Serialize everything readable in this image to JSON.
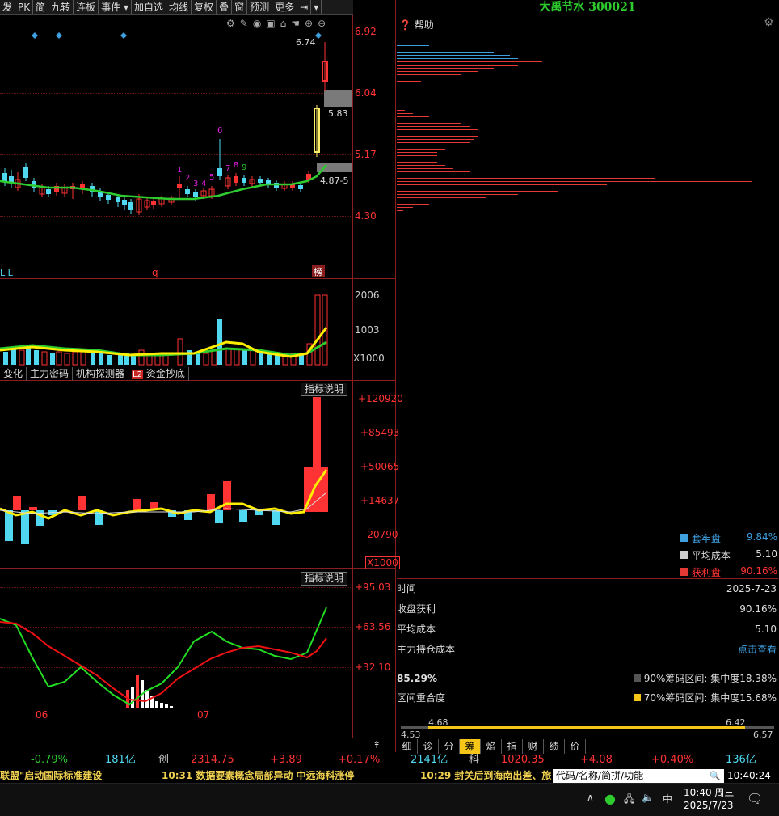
{
  "toolbar": {
    "items": [
      "发",
      "PK",
      "简",
      "九转",
      "连板",
      "事件 ▾",
      "加自选",
      "均线",
      "复权",
      "叠",
      "窗",
      "预测",
      "更多"
    ],
    "more_arrow": "▾"
  },
  "stock": {
    "title": "大禹节水 300021"
  },
  "main_chart": {
    "price_axis": [
      "6.92",
      "6.04",
      "5.17",
      "4.30"
    ],
    "labels": {
      "high": "6.74",
      "mid": "5.83",
      "low": "4.87-5"
    },
    "marks": {
      "ll": "L L",
      "q": "q",
      "bang": "榜"
    },
    "nums": [
      "1",
      "2",
      "3",
      "4",
      "5",
      "6",
      "7",
      "8",
      "9"
    ]
  },
  "volume": {
    "axis": [
      "2006",
      "1003",
      "X1000"
    ]
  },
  "tabs2": [
    "变化",
    "主力密码",
    "机构探测器",
    "资金抄底"
  ],
  "tabs2_badge": "L2",
  "indicator1": {
    "button": "指标说明",
    "axis": [
      "+120920",
      "+85493",
      "+50065",
      "+14637",
      "-20790",
      "X1000"
    ]
  },
  "indicator2": {
    "button": "指标说明",
    "axis": [
      "+95.03",
      "+63.56",
      "+32.10"
    ],
    "dates": [
      "06",
      "07"
    ]
  },
  "chip": {
    "help": "帮助",
    "legend": [
      {
        "label": "套牢盘",
        "value": "9.84%",
        "color": "#3fa0e0"
      },
      {
        "label": "平均成本",
        "value": "5.10",
        "color": "#cccccc"
      },
      {
        "label": "获利盘",
        "value": "90.16%",
        "color": "#e53935"
      }
    ],
    "rows": [
      {
        "label": "时间",
        "value": "2025-7-23"
      },
      {
        "label": "收盘获利",
        "value": "90.16%"
      },
      {
        "label": "平均成本",
        "value": "5.10"
      },
      {
        "label": "主力持仓成本",
        "value": "点击查看"
      }
    ],
    "concentration": {
      "pct": "85.29%",
      "overlap_label": "区间重合度",
      "c90": "90%筹码区间: 集中度18.38%",
      "c70": "70%筹码区间: 集中度15.68%"
    },
    "range": {
      "a": "4.68",
      "b": "6.42",
      "min": "4.53",
      "max": "6.57"
    },
    "tabs": [
      "细",
      "诊",
      "分",
      "筹",
      "焰",
      "指",
      "财",
      "绩",
      "价"
    ],
    "selected_tab": "筹"
  },
  "indexbar": {
    "pct1": "-0.79%",
    "amt1": "181亿",
    "tag2": "创",
    "val2": "2314.75",
    "chg2": "+3.89",
    "pct2": "+0.17%",
    "amt2": "2141亿",
    "tag3": "科",
    "val3": "1020.35",
    "chg3": "+4.08",
    "pct3": "+0.40%",
    "amt3": "136亿"
  },
  "ticker": {
    "t1": "联盟\"启动国际标准建设",
    "t2": "10:31 数据要素概念局部异动 中远海科涨停",
    "t3": "10:29 封关后到海南出差、旅",
    "search_placeholder": "代码/名称/简拼/功能",
    "clock": "10:40:24"
  },
  "taskbar": {
    "time": "10:40 周三",
    "date": "2025/7/23",
    "ime": "中"
  },
  "colors": {
    "up": "#ff3333",
    "down": "#4fd8f0",
    "ma": "#2ecc2e",
    "yellow": "#ffee00",
    "grid": "#8a1d1d"
  }
}
